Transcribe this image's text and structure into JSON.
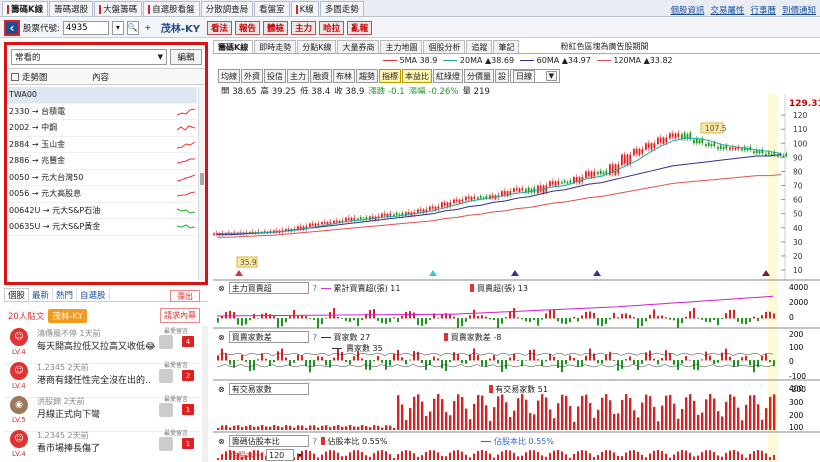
{
  "top_tabs": [
    "籌碼K線",
    "籌碼選股",
    "大盤籌碼",
    "自選股看盤",
    "分散調查局",
    "看盤室",
    "K線",
    "多圖走勢"
  ],
  "top_links": [
    "個股資訊",
    "交易屬性",
    "行事曆",
    "到價通知"
  ],
  "toolbar": {
    "code_label": "股票代號:",
    "code_value": "4935",
    "stock_name": "茂林-KY",
    "buttons": [
      "看法",
      "報告",
      "體檢",
      "主力",
      "哈拉",
      "亂報"
    ]
  },
  "watchlist": {
    "selected": "常看的",
    "edit": "編輯",
    "col_trend": "走勢圖",
    "col_content": "內容",
    "rows": [
      "TWA00",
      "2330 → 台積電",
      "2002 → 中鋼",
      "2884 → 玉山金",
      "2886 → 兆豐金",
      "0050 → 元大台灣50",
      "0056 → 元大高股息",
      "00642U → 元大S&P石油",
      "00635U → 元大S&P黃金"
    ]
  },
  "social": {
    "tabs": [
      "個股",
      "最新",
      "熱門",
      "自選股"
    ],
    "popout": "彈出",
    "members": "20人貼文",
    "stock_chip": "茂林-KY",
    "request": "請求內幕",
    "last_label": "最愛留言",
    "posts": [
      {
        "user": "鴻傳風不停",
        "time": "1天前",
        "text": "每天開高拉低又拉高又收低😂",
        "level": "LV.4",
        "count": "4"
      },
      {
        "user": "1.2345",
        "time": "2天前",
        "text": "港商有錢任性完全沒在出的..",
        "level": "LV.4",
        "count": "2"
      },
      {
        "user": "洪股錦",
        "time": "2天前",
        "text": "月線正式向下彎",
        "level": "LV.5",
        "count": "1"
      },
      {
        "user": "1.2345",
        "time": "2天前",
        "text": "看市場捧長傷了",
        "level": "LV.4",
        "count": "1"
      }
    ]
  },
  "chart_tabs": [
    "籌碼K線",
    "即時走勢",
    "分點K線",
    "大量券商",
    "主力地圖",
    "個股分析",
    "追蹤",
    "筆記"
  ],
  "chart_title": "粉紅色區塊為廣告股期間",
  "ma_legend": [
    {
      "label": "5MA",
      "value": "38.9",
      "color": "#e03030"
    },
    {
      "label": "20MA",
      "value": "▲38.69",
      "color": "#20a8a0"
    },
    {
      "label": "60MA",
      "value": "▲34.97",
      "color": "#303090"
    },
    {
      "label": "120MA",
      "value": "▲33.82",
      "color": "#e05050"
    }
  ],
  "indicator_buttons": [
    "均線",
    "外資",
    "投信",
    "主力",
    "融資",
    "布林",
    "趨勢",
    "指標",
    "本益比",
    "紅綠燈",
    "分價量",
    "設"
  ],
  "period": "日線",
  "ohlc": {
    "open": "開 38.65",
    "high": "高 39.25",
    "low": "低 38.4",
    "close": "收 38.9",
    "change": "漲跌 -0.1",
    "pct": "漲幅 -0.26%",
    "vol": "量 219"
  },
  "price_axis": [
    "129.31",
    "120",
    "110",
    "100",
    "90",
    "80",
    "70",
    "60",
    "50",
    "40",
    "30",
    "20",
    "10"
  ],
  "high_label": "107.5",
  "low_label": "35.9",
  "panels": [
    {
      "select": "主力買賣超",
      "legend1": "累計買賣超(張) 11",
      "legend2": "買賣超(張) 13",
      "axis": [
        "4000",
        "2000",
        "0"
      ]
    },
    {
      "select": "買賣家數差",
      "legend1": "買家數 27",
      "legend2": "買賣家數差 -8",
      "legend3": "賣家數 35",
      "axis": [
        "200",
        "100",
        "0",
        "-100",
        "-200"
      ]
    },
    {
      "select": "有交易家數",
      "legend1": "有交易家數 51",
      "axis": [
        "400",
        "300",
        "200",
        "100"
      ]
    },
    {
      "select": "籌碼佔股本比",
      "legend1": "佔股本比 0.55%",
      "legend2": "佔股本比 0.55%",
      "sub_label": "佔股本一",
      "sub_value": "120"
    }
  ],
  "chart_data": {
    "type": "line",
    "title": "",
    "xlabel": "",
    "ylabel": "",
    "ylim": [
      10,
      129.31
    ],
    "close_approx": [
      36,
      36,
      36.5,
      37,
      37,
      38,
      39,
      41,
      43,
      44,
      45,
      47,
      46,
      48,
      50,
      49,
      51,
      53,
      55,
      58,
      60,
      62,
      61,
      63,
      66,
      68,
      65,
      70,
      73,
      72,
      76,
      80,
      78,
      85,
      92,
      96,
      100,
      104,
      107,
      103,
      100,
      98,
      96,
      97,
      95,
      93,
      92,
      91
    ],
    "ma60_approx": [
      35,
      35,
      35.5,
      36,
      36.5,
      37,
      38,
      39,
      40,
      41,
      42,
      43,
      44,
      45,
      46,
      47,
      48,
      49,
      50,
      52,
      53,
      55,
      56,
      58,
      59,
      61,
      62,
      64,
      66,
      67,
      69,
      71,
      72,
      74,
      76,
      78,
      80,
      82,
      84,
      85,
      86,
      87,
      88,
      89,
      90,
      91,
      91,
      92
    ]
  }
}
